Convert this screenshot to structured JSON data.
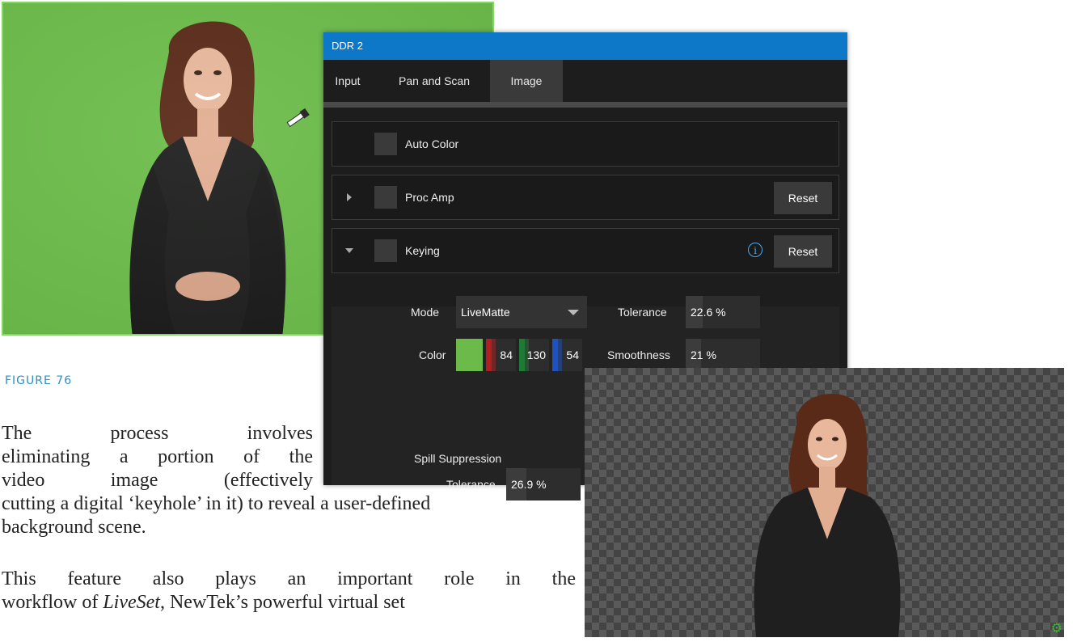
{
  "figure": {
    "caption": "FIGURE 76"
  },
  "paragraphs": {
    "line1": "The process involves",
    "line2": "eliminating a portion of the",
    "line3": "video image (effectively",
    "line4": "cutting a digital ‘keyhole’ in it) to reveal a user-defined",
    "line5": "background scene.",
    "p2_line1": "This feature also plays an important role in the",
    "p2_line2_pre": "workflow of ",
    "p2_line2_italic": "LiveSet",
    "p2_line2_post": ", NewTek’s powerful virtual set"
  },
  "dialog": {
    "title": "DDR 2",
    "tabs": [
      {
        "label": "Input",
        "active": false
      },
      {
        "label": "Pan and Scan",
        "active": false
      },
      {
        "label": "Image",
        "active": true
      }
    ],
    "auto_color": {
      "label": "Auto Color",
      "checked": false
    },
    "proc_amp": {
      "label": "Proc Amp",
      "expanded": false,
      "checked": false,
      "reset_label": "Reset"
    },
    "keying": {
      "label": "Keying",
      "expanded": true,
      "checked": false,
      "info_icon": "info-icon",
      "reset_label": "Reset",
      "mode_label": "Mode",
      "mode_value": "LiveMatte",
      "color_label": "Color",
      "color_swatch": "#6cba4a",
      "color_r": "84",
      "color_g": "130",
      "color_b": "54",
      "tolerance_label": "Tolerance",
      "tolerance_value": "22.6 %",
      "tolerance_level": 0.226,
      "smoothness_label": "Smoothness",
      "smoothness_value": "21 %",
      "smoothness_level": 0.21,
      "spill_suppression_label": "Spill Suppression",
      "spill_tolerance_label": "Tolerance",
      "spill_tolerance_value": "26.9 %",
      "spill_tolerance_level": 0.269
    }
  },
  "keyed_image": {
    "settings_icon": "gear-icon"
  },
  "colors": {
    "accent": "#0e78c8",
    "green_screen": "#6cbd4a",
    "caption": "#2e8fc9"
  }
}
